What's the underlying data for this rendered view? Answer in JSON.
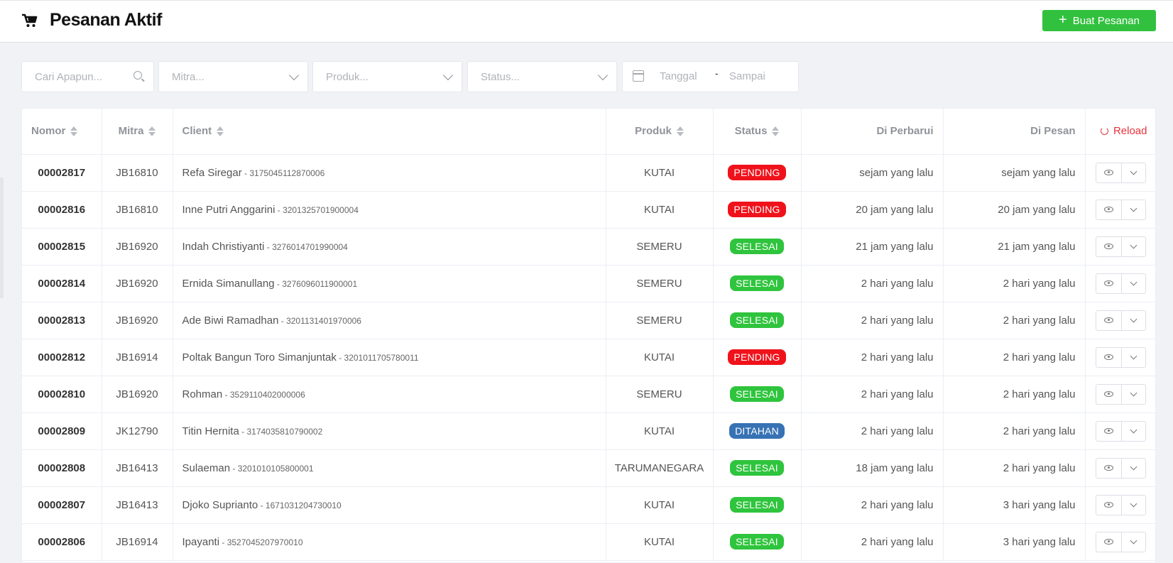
{
  "header": {
    "title": "Pesanan Aktif",
    "create_button": "Buat Pesanan"
  },
  "filters": {
    "search_placeholder": "Cari Apapun...",
    "mitra_placeholder": "Mitra...",
    "produk_placeholder": "Produk...",
    "status_placeholder": "Status...",
    "date_from": "Tanggal",
    "date_separator": "-",
    "date_to": "Sampai"
  },
  "table": {
    "columns": {
      "nomor": "Nomor",
      "mitra": "Mitra",
      "client": "Client",
      "produk": "Produk",
      "status": "Status",
      "updated": "Di Perbarui",
      "ordered": "Di Pesan",
      "reload": "Reload"
    },
    "rows": [
      {
        "nomor": "00002817",
        "mitra": "JB16810",
        "client": "Refa Siregar",
        "nik": " - 3175045112870006",
        "produk": "KUTAI",
        "status": "PENDING",
        "updated": "sejam yang lalu",
        "ordered": "sejam yang lalu"
      },
      {
        "nomor": "00002816",
        "mitra": "JB16810",
        "client": "Inne Putri Anggarini",
        "nik": " - 3201325701900004",
        "produk": "KUTAI",
        "status": "PENDING",
        "updated": "20 jam yang lalu",
        "ordered": "20 jam yang lalu"
      },
      {
        "nomor": "00002815",
        "mitra": "JB16920",
        "client": "Indah Christiyanti",
        "nik": " - 3276014701990004",
        "produk": "SEMERU",
        "status": "SELESAI",
        "updated": "21 jam yang lalu",
        "ordered": "21 jam yang lalu"
      },
      {
        "nomor": "00002814",
        "mitra": "JB16920",
        "client": "Ernida Simanullang",
        "nik": " - 3276096011900001",
        "produk": "SEMERU",
        "status": "SELESAI",
        "updated": "2 hari yang lalu",
        "ordered": "2 hari yang lalu"
      },
      {
        "nomor": "00002813",
        "mitra": "JB16920",
        "client": "Ade Biwi Ramadhan",
        "nik": " - 3201131401970006",
        "produk": "SEMERU",
        "status": "SELESAI",
        "updated": "2 hari yang lalu",
        "ordered": "2 hari yang lalu"
      },
      {
        "nomor": "00002812",
        "mitra": "JB16914",
        "client": "Poltak Bangun Toro Simanjuntak",
        "nik": " - 3201011705780011",
        "produk": "KUTAI",
        "status": "PENDING",
        "updated": "2 hari yang lalu",
        "ordered": "2 hari yang lalu"
      },
      {
        "nomor": "00002810",
        "mitra": "JB16920",
        "client": "Rohman",
        "nik": " - 3529110402000006",
        "produk": "SEMERU",
        "status": "SELESAI",
        "updated": "2 hari yang lalu",
        "ordered": "2 hari yang lalu"
      },
      {
        "nomor": "00002809",
        "mitra": "JK12790",
        "client": "Titin Hernita",
        "nik": " - 3174035810790002",
        "produk": "KUTAI",
        "status": "DITAHAN",
        "updated": "2 hari yang lalu",
        "ordered": "2 hari yang lalu"
      },
      {
        "nomor": "00002808",
        "mitra": "JB16413",
        "client": "Sulaeman",
        "nik": " - 3201010105800001",
        "produk": "TARUMANEGARA",
        "status": "SELESAI",
        "updated": "18 jam yang lalu",
        "ordered": "2 hari yang lalu"
      },
      {
        "nomor": "00002807",
        "mitra": "JB16413",
        "client": "Djoko Suprianto",
        "nik": " - 1671031204730010",
        "produk": "KUTAI",
        "status": "SELESAI",
        "updated": "2 hari yang lalu",
        "ordered": "3 hari yang lalu"
      },
      {
        "nomor": "00002806",
        "mitra": "JB16914",
        "client": "Ipayanti",
        "nik": " - 3527045207970010",
        "produk": "KUTAI",
        "status": "SELESAI",
        "updated": "2 hari yang lalu",
        "ordered": "3 hari yang lalu"
      }
    ]
  },
  "status_colors": {
    "PENDING": "#f0121b",
    "SELESAI": "#2fc43d",
    "DITAHAN": "#3672b4"
  },
  "icons": {
    "header": "cart-icon",
    "create": "plus-icon",
    "search": "search-icon",
    "dropdown": "chevron-down-icon",
    "date": "calendar-icon",
    "sort": "sort-icon",
    "reload": "refresh-icon",
    "view": "eye-icon"
  }
}
